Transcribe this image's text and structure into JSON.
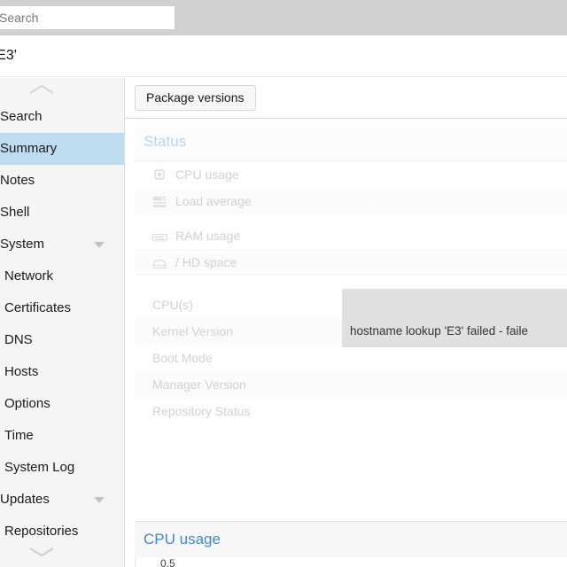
{
  "topbar": {
    "search_placeholder": "Search",
    "search_value": ""
  },
  "header": {
    "title": "'E3'"
  },
  "sidebar": {
    "scroll_up_icon": "chevron-up-icon",
    "scroll_down_icon": "chevron-down-icon",
    "items": [
      {
        "label": "Search",
        "level": 0,
        "selected": false,
        "caret": false
      },
      {
        "label": "Summary",
        "level": 0,
        "selected": true,
        "caret": false
      },
      {
        "label": "Notes",
        "level": 0,
        "selected": false,
        "caret": false
      },
      {
        "label": "Shell",
        "level": 0,
        "selected": false,
        "caret": false
      },
      {
        "label": "System",
        "level": 0,
        "selected": false,
        "caret": true
      },
      {
        "label": "Network",
        "level": 1,
        "selected": false,
        "caret": false
      },
      {
        "label": "Certificates",
        "level": 1,
        "selected": false,
        "caret": false
      },
      {
        "label": "DNS",
        "level": 1,
        "selected": false,
        "caret": false
      },
      {
        "label": "Hosts",
        "level": 1,
        "selected": false,
        "caret": false
      },
      {
        "label": "Options",
        "level": 1,
        "selected": false,
        "caret": false
      },
      {
        "label": "Time",
        "level": 1,
        "selected": false,
        "caret": false
      },
      {
        "label": "System Log",
        "level": 1,
        "selected": false,
        "caret": false
      },
      {
        "label": "Updates",
        "level": 0,
        "selected": false,
        "caret": true
      },
      {
        "label": "Repositories",
        "level": 1,
        "selected": false,
        "caret": false
      }
    ]
  },
  "main": {
    "toolbar": {
      "package_versions_label": "Package versions"
    },
    "status_panel": {
      "title": "Status",
      "rows": [
        {
          "label": "CPU usage",
          "icon": "cpu-chip-icon",
          "value": ""
        },
        {
          "label": "Load average",
          "icon": "server-list-icon",
          "value": ""
        },
        {
          "label": "RAM usage",
          "icon": "memory-ram-icon",
          "value": ""
        },
        {
          "label": "/ HD space",
          "icon": "hard-disk-icon",
          "value": ""
        },
        {
          "label": "CPU(s)",
          "icon": "",
          "value": ""
        },
        {
          "label": "Kernel Version",
          "icon": "",
          "value": ""
        },
        {
          "label": "Boot Mode",
          "icon": "",
          "value": ""
        },
        {
          "label": "Manager Version",
          "icon": "",
          "value": ""
        },
        {
          "label": "Repository Status",
          "icon": "",
          "value": ""
        }
      ]
    },
    "tooltip": {
      "message": "hostname lookup 'E3' failed - faile"
    },
    "chart_panel": {
      "title": "CPU usage",
      "y_tick": "0.5"
    }
  },
  "colors": {
    "topbar_background": "#d0d0d0",
    "sidebar_background": "#f5f5f5",
    "selected_item_background": "#bedcf0",
    "panel_title_muted": "#8fbce4",
    "chart_title": "#3a8ada",
    "tooltip_background": "#e0e0e0",
    "status_text": "#b6b6b6"
  },
  "chart_data": {
    "type": "line",
    "title": "CPU usage",
    "xlabel": "",
    "ylabel": "",
    "x": [],
    "values": [],
    "yticks": [
      "0.5"
    ],
    "ylim": [
      0,
      1
    ],
    "grid": true,
    "legend": "none",
    "note": "chart area is clipped at the bottom edge of the screenshot; only the 0.5 y-axis tick is partially visible"
  }
}
